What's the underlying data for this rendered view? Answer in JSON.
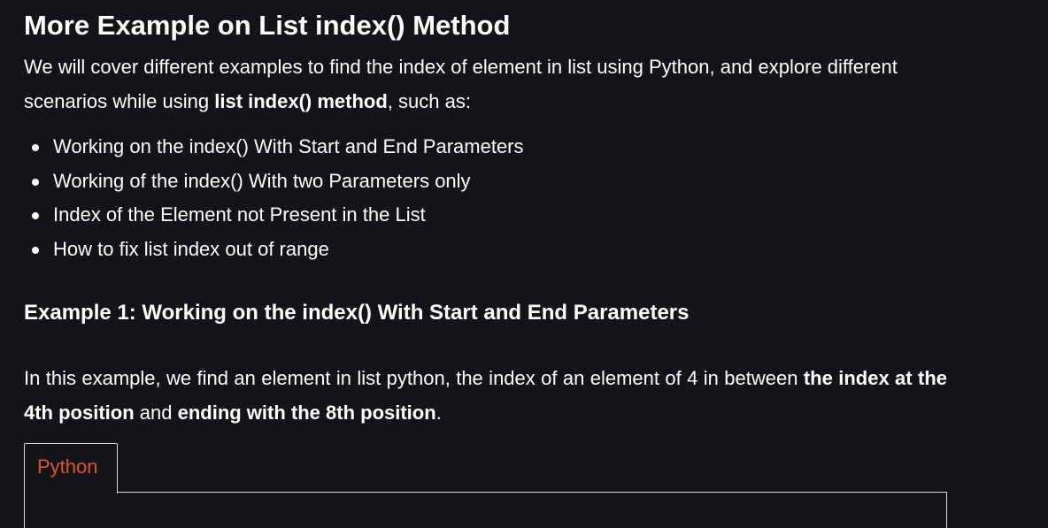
{
  "heading": "More Example on List index() Method",
  "intro": {
    "part1": "We will cover different examples to find the index of element in list using Python, and explore different scenarios while using ",
    "bold": "list index() method",
    "part2": ", such as:"
  },
  "cases": [
    "Working on the index() With Start and End Parameters",
    "Working of the index() With two Parameters only",
    "Index of the Element not Present in the List",
    "How to fix list index out of range"
  ],
  "example1": {
    "title": "Example 1: Working on the index() With Start and End Parameters",
    "desc_part1": "In this example, we find an element in list python, the index of an element of 4 in between ",
    "desc_bold1": "the index at the 4th position",
    "desc_part2": " and ",
    "desc_bold2": "ending with the 8th position",
    "desc_part3": "."
  },
  "code_tabs": {
    "active": "Python",
    "accent_color": "#e0552a"
  },
  "colors": {
    "background": "#131417",
    "text": "#ffffff",
    "border": "#d9d9d9"
  }
}
